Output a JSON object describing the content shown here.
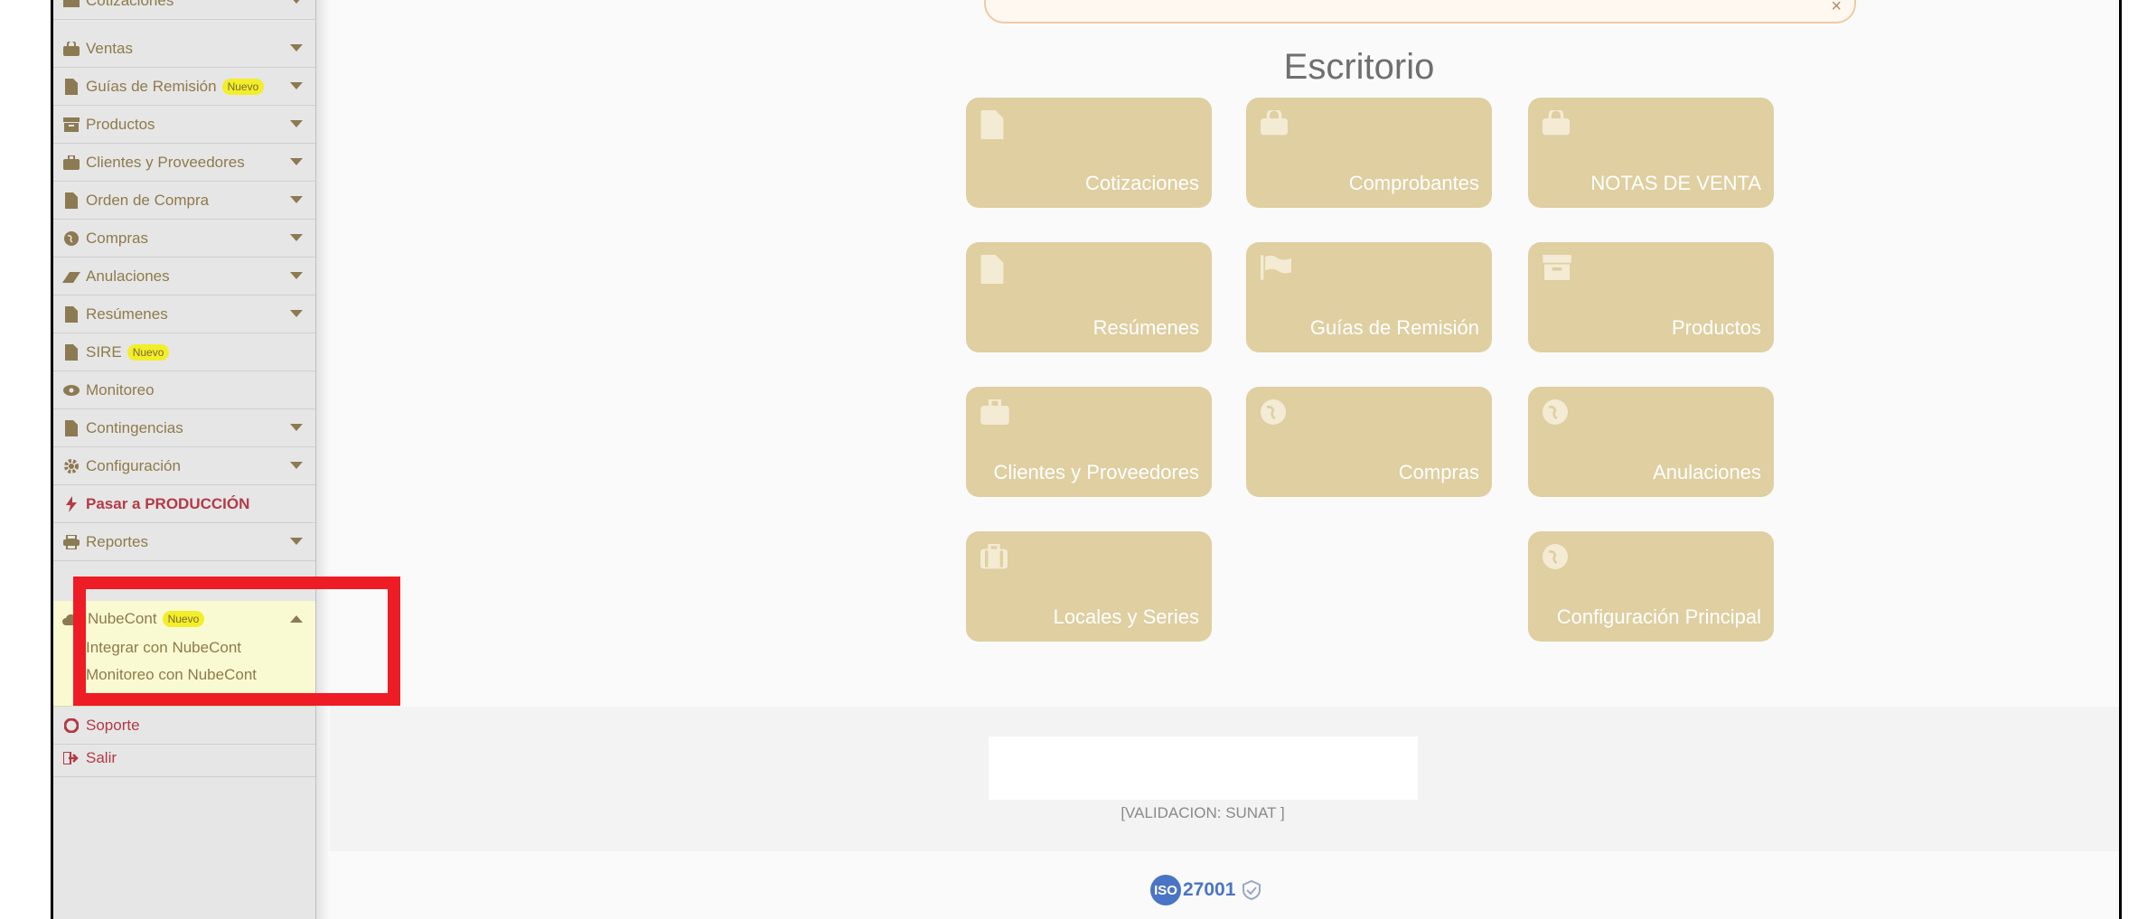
{
  "sidebar": {
    "items": [
      {
        "label": "Cotizaciones",
        "icon": "folder-icon",
        "caret": "down"
      },
      {
        "label": "Ventas",
        "icon": "shopping-bag-icon",
        "caret": "down"
      },
      {
        "label": "Guías de Remisión",
        "icon": "file-icon",
        "caret": "down",
        "badge": "Nuevo"
      },
      {
        "label": "Productos",
        "icon": "archive-icon",
        "caret": "down"
      },
      {
        "label": "Clientes y Proveedores",
        "icon": "briefcase-icon",
        "caret": "down"
      },
      {
        "label": "Orden de Compra",
        "icon": "file-icon",
        "caret": "down"
      },
      {
        "label": "Compras",
        "icon": "globe-icon",
        "caret": "down"
      },
      {
        "label": "Anulaciones",
        "icon": "eraser-icon",
        "caret": "down"
      },
      {
        "label": "Resúmenes",
        "icon": "file-icon",
        "caret": "down"
      },
      {
        "label": "SIRE",
        "icon": "file-icon",
        "badge": "Nuevo"
      },
      {
        "label": "Monitoreo",
        "icon": "eye-icon"
      },
      {
        "label": "Contingencias",
        "icon": "file-icon",
        "caret": "down"
      },
      {
        "label": "Configuración",
        "icon": "gear-icon",
        "caret": "down"
      },
      {
        "label": "Pasar a PRODUCCIÓN",
        "icon": "bolt-icon",
        "style": "danger"
      },
      {
        "label": "Reportes",
        "icon": "printer-icon",
        "caret": "down"
      }
    ],
    "nubecont": {
      "label": "NubeCont",
      "badge": "Nuevo",
      "icon": "cloud-icon",
      "sub_items": [
        "Integrar con NubeCont",
        "Monitoreo con NubeCont"
      ]
    },
    "soporte": {
      "label": "Soporte",
      "icon": "support-icon"
    },
    "salir": {
      "label": "Salir",
      "icon": "sign-out-icon"
    }
  },
  "main": {
    "title": "Escritorio",
    "tiles": [
      {
        "label": "Cotizaciones",
        "icon": "file-icon"
      },
      {
        "label": "Comprobantes",
        "icon": "shopping-bag-icon"
      },
      {
        "label": "NOTAS DE VENTA",
        "icon": "shopping-bag-icon"
      },
      {
        "label": "Resúmenes",
        "icon": "file-icon"
      },
      {
        "label": "Guías de Remisión",
        "icon": "flag-icon"
      },
      {
        "label": "Productos",
        "icon": "archive-icon"
      },
      {
        "label": "Clientes y Proveedores",
        "icon": "briefcase-icon"
      },
      {
        "label": "Compras",
        "icon": "globe-icon"
      },
      {
        "label": "Anulaciones",
        "icon": "globe-icon"
      },
      {
        "label": "Locales y Series",
        "icon": "suitcase-icon"
      },
      {
        "label": "Configuración Principal",
        "icon": "globe-icon"
      }
    ]
  },
  "footer": {
    "validation": "[VALIDACION: SUNAT ]",
    "iso_mark": "ISO",
    "iso_number": "27001"
  },
  "colors": {
    "tile": "#dfcfa1",
    "sidebar_text": "#8f7a4a",
    "badge": "#f3ee2a",
    "danger": "#b23a46",
    "highlight": "#ee1c25"
  }
}
